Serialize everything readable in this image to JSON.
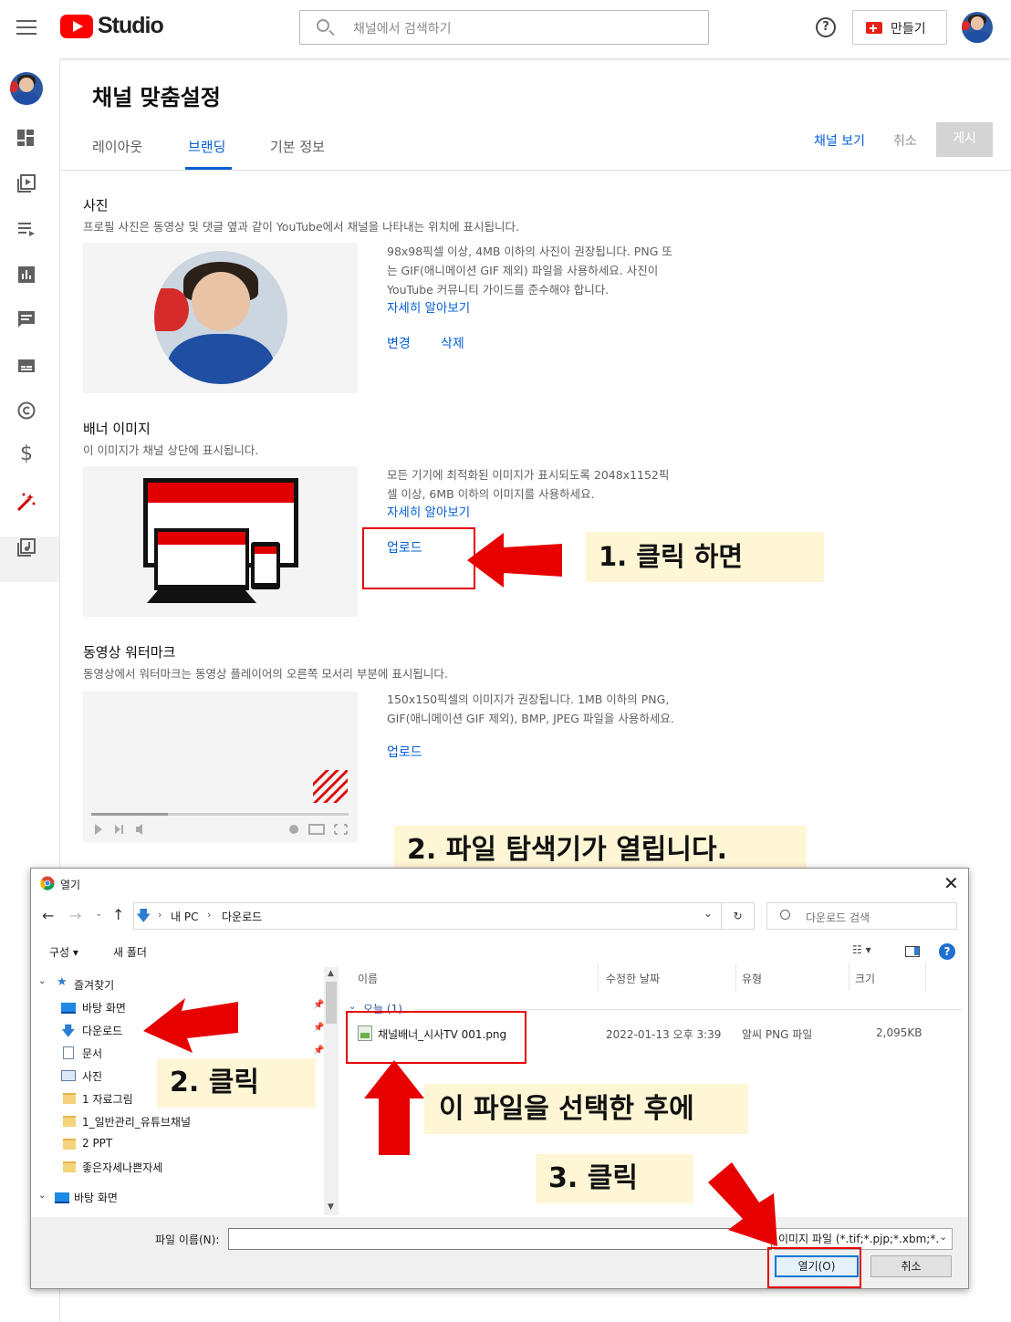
{
  "header": {
    "logo_text": "Studio",
    "search_placeholder": "채널에서 검색하기",
    "help_glyph": "?",
    "create_label": "만들기"
  },
  "page": {
    "title": "채널 맞춤설정",
    "tabs": [
      {
        "label": "레이아웃"
      },
      {
        "label": "브랜딩"
      },
      {
        "label": "기본 정보"
      }
    ],
    "active_tab": "브랜딩",
    "view_channel": "채널 보기",
    "cancel": "취소",
    "publish": "게시"
  },
  "photo": {
    "title": "사진",
    "description": "프로필 사진은 동영상 및 댓글 옆과 같이 YouTube에서 채널을 나타내는 위치에 표시됩니다.",
    "info_lines": [
      "98x98픽셀 이상, 4MB 이하의 사진이 권장됩니다. PNG 또",
      "는 GIF(애니메이션 GIF 제외) 파일을 사용하세요. 사진이",
      "YouTube 커뮤니티 가이드를 준수해야 합니다."
    ],
    "learn_more": "자세히 알아보기",
    "change": "변경",
    "delete": "삭제"
  },
  "banner": {
    "title": "배너 이미지",
    "description": "이 이미지가 채널 상단에 표시됩니다.",
    "info_lines": [
      "모든 기기에 최적화된 이미지가 표시되도록 2048x1152픽",
      "셀 이상, 6MB 이하의 이미지를 사용하세요."
    ],
    "learn_more": "자세히 알아보기",
    "upload": "업로드"
  },
  "watermark": {
    "title": "동영상 워터마크",
    "description": "동영상에서 워터마크는 동영상 플레이어의 오른쪽 모서리 부분에 표시됩니다.",
    "info_lines": [
      "150x150픽셀의 이미지가 권장됩니다. 1MB 이하의 PNG,",
      "GIF(애니메이션 GIF 제외), BMP, JPEG 파일을 사용하세요."
    ],
    "upload": "업로드"
  },
  "annotations": {
    "step1": "1. 클릭 하면",
    "step2_open": "2. 파일 탐색기가 열립니다.",
    "step2_click": "2. 클릭",
    "select_file": "이 파일을 선택한 후에",
    "step3": "3. 클릭",
    "accent": "#e60000"
  },
  "dialog": {
    "title": "열기",
    "close": "✕",
    "breadcrumb": [
      "내 PC",
      "다운로드"
    ],
    "search_placeholder": "다운로드 검색",
    "organize": "구성 ▾",
    "new_folder": "새 폴더",
    "nav": {
      "quick_access": "즐겨찾기",
      "items": [
        "바탕 화면",
        "다운로드",
        "문서",
        "사진",
        "1 자료그림",
        "1_일반관리_유튜브채널",
        "2 PPT",
        "좋은자세나쁜자세"
      ],
      "desktop": "바탕 화면"
    },
    "columns": [
      "이름",
      "수정한 날짜",
      "유형",
      "크기"
    ],
    "group": "오늘 (1)",
    "file": {
      "name": "채널배너_시사TV 001.png",
      "date": "2022-01-13 오후 3:39",
      "type": "알씨 PNG 파일",
      "size": "2,095KB"
    },
    "filename_label": "파일 이름(N):",
    "filter": "이미지 파일 (*.tif;*.pjp;*.xbm;*.",
    "open_button": "열기(O)",
    "cancel_button": "취소"
  }
}
